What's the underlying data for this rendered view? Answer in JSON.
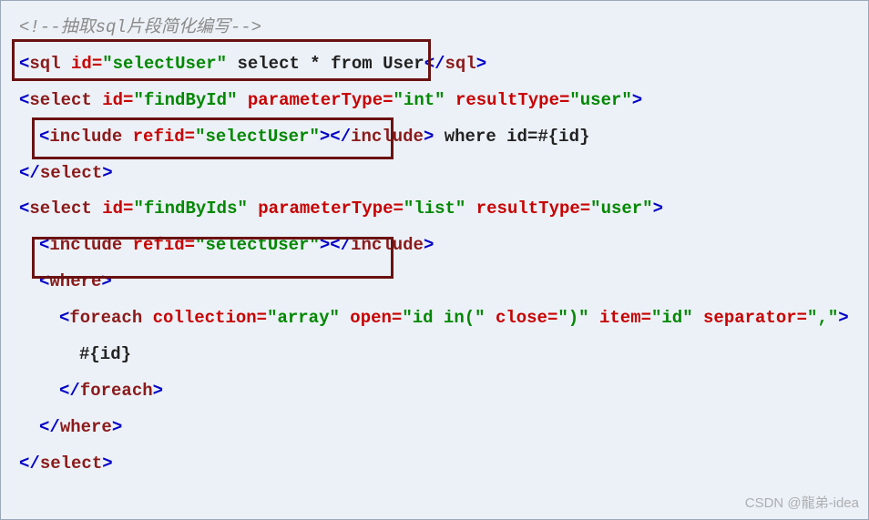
{
  "comment": "<!--抽取sql片段简化编写-->",
  "sqlTag": {
    "open": "<",
    "name": "sql",
    "idAttr": "id=",
    "idVal": "\"selectUser\"",
    "close": ">",
    "content": " select * from User",
    "endOpen": "</",
    "endClose": ">"
  },
  "select1": {
    "open": "<",
    "name": "select",
    "idAttr": "id=",
    "idVal": "\"findById\"",
    "ptAttr": "parameterType=",
    "ptVal": "\"int\"",
    "rtAttr": "resultType=",
    "rtVal": "\"user\"",
    "close": ">",
    "include": {
      "open": "<",
      "name": "include",
      "refAttr": "refid=",
      "refVal": "\"selectUser\"",
      "close": ">",
      "endOpen": "</",
      "endClose": ">"
    },
    "where": " where id=#{id}",
    "endOpen": "</",
    "endClose": ">"
  },
  "select2": {
    "open": "<",
    "name": "select",
    "idAttr": "id=",
    "idVal": "\"findByIds\"",
    "ptAttr": "parameterType=",
    "ptVal": "\"list\"",
    "rtAttr": "resultType=",
    "rtVal": "\"user\"",
    "close": ">",
    "include": {
      "open": "<",
      "name": "include",
      "refAttr": "refid=",
      "refVal": "\"selectUser\"",
      "close": ">",
      "endOpen": "</",
      "endClose": ">"
    },
    "whereTag": {
      "open": "<",
      "name": "where",
      "close": ">",
      "endOpen": "</",
      "endClose": ">"
    },
    "foreach": {
      "open": "<",
      "name": "foreach",
      "colAttr": "collection=",
      "colVal": "\"array\"",
      "openAttr": "open=",
      "openVal": "\"id in(\"",
      "closeAttr": "close=",
      "closeVal": "\")\"",
      "itemAttr": "item=",
      "itemVal": "\"id\"",
      "sepAttr": "separator=",
      "sepVal": "\",\"",
      "close": ">",
      "body": "#{id}",
      "endOpen": "</",
      "endClose": ">"
    },
    "endOpen": "</",
    "endClose": ">"
  },
  "watermark": "CSDN @龍弟-idea"
}
